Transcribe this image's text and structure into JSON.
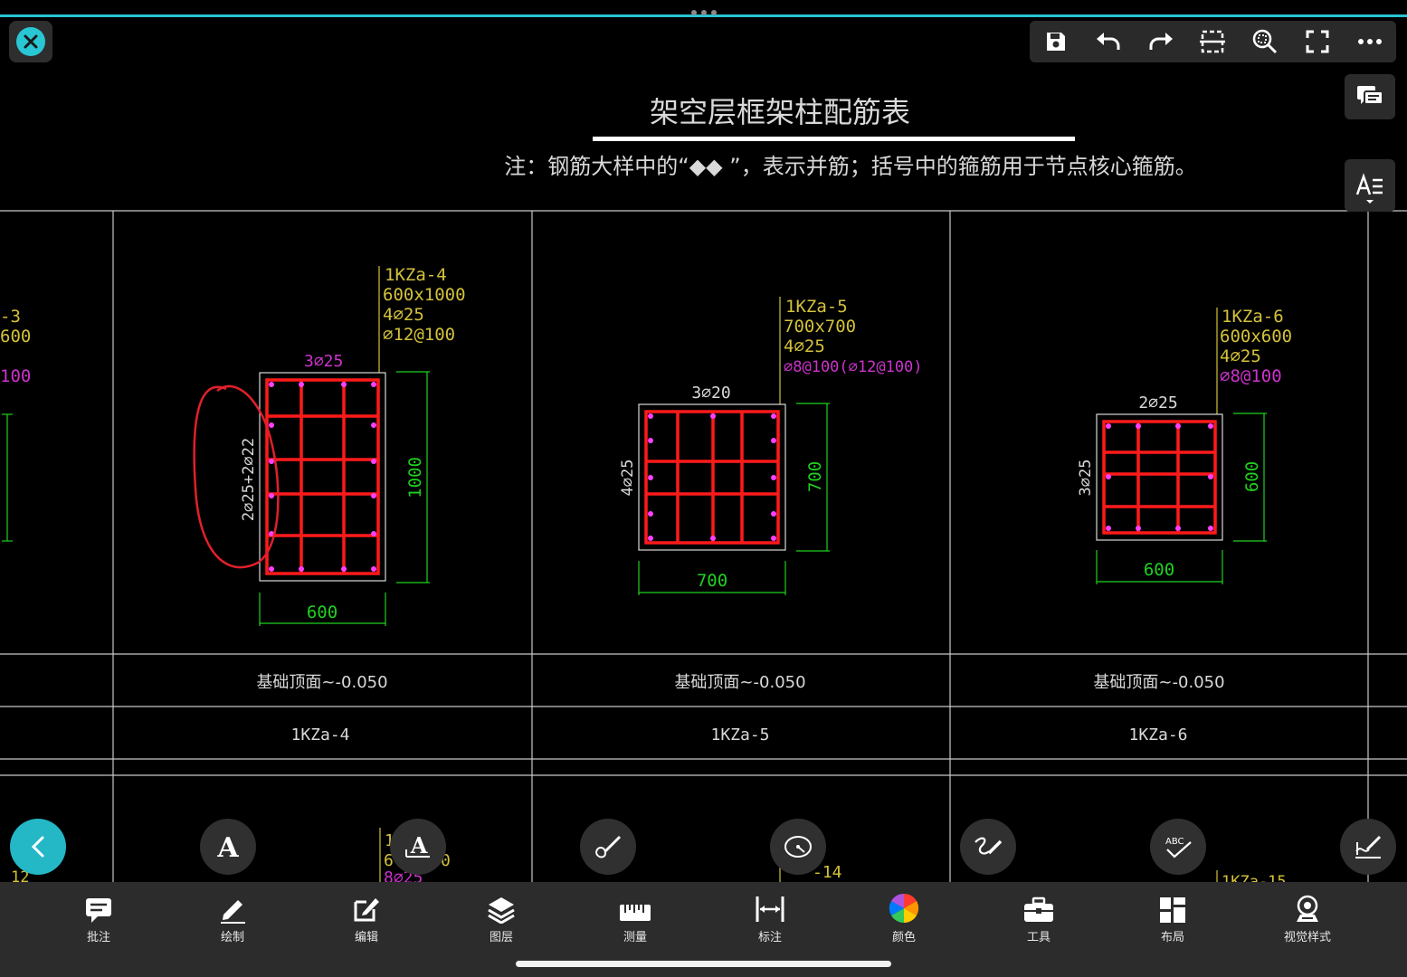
{
  "drawing": {
    "title": "架空层框架柱配筋表",
    "note": "注：钢筋大样中的“◆◆ ”，表示并筋；括号中的箍筋用于节点核心箍筋。",
    "left_partial": {
      "name": "-3",
      "size": "600",
      "stirrup": "100",
      "bottom_label": "12"
    },
    "columns": [
      {
        "id": "1KZa-4",
        "size": "600x1000",
        "corner": "4⌀25",
        "stirrup": "⌀12@100",
        "top_bar": "3⌀25",
        "side_bar": "2⌀25+2⌀22",
        "width_dim": "600",
        "height_dim": "1000",
        "elevation": "基础顶面~-0.050",
        "name": "1KZa-4"
      },
      {
        "id": "1KZa-5",
        "size": "700x700",
        "corner": "4⌀25",
        "stirrup": "⌀8@100(⌀12@100)",
        "top_bar": "3⌀20",
        "side_bar": "4⌀25",
        "width_dim": "700",
        "height_dim": "700",
        "elevation": "基础顶面~-0.050",
        "name": "1KZa-5"
      },
      {
        "id": "1KZa-6",
        "size": "600x600",
        "corner": "4⌀25",
        "stirrup": "⌀8@100",
        "top_bar": "2⌀25",
        "side_bar": "3⌀25",
        "width_dim": "600",
        "height_dim": "600",
        "elevation": "基础顶面~-0.050",
        "name": "1KZa-6"
      }
    ],
    "next_row_fragments": [
      "1",
      "6",
      "8⌀25",
      "0",
      "-14",
      "1KZa-15"
    ]
  },
  "colors": {
    "accent": "#29c6d4",
    "frame": "#d9d9d9",
    "rebar": "#ff1a1a",
    "dot": "#ff40ff",
    "dim": "#1fd11f",
    "label": "#d4c23a",
    "stirrup_label": "#cc33cc",
    "markup": "#e0202a"
  },
  "top_toolbar": {
    "icons": [
      "save-icon",
      "undo-icon",
      "redo-icon",
      "crop-icon",
      "zoom-icon",
      "fullscreen-icon",
      "more-icon"
    ]
  },
  "side_buttons": [
    "comment-list-icon",
    "text-format-icon"
  ],
  "fab_tools": [
    "back-icon",
    "text-icon",
    "text-annotation-icon",
    "brush-icon",
    "measure-circle-icon",
    "freehand-icon",
    "spell-check-icon",
    "sign-icon"
  ],
  "bottom_bar": [
    {
      "label": "批注",
      "icon": "comment-icon"
    },
    {
      "label": "绘制",
      "icon": "pencil-icon"
    },
    {
      "label": "编辑",
      "icon": "edit-icon"
    },
    {
      "label": "图层",
      "icon": "layers-icon"
    },
    {
      "label": "测量",
      "icon": "ruler-icon"
    },
    {
      "label": "标注",
      "icon": "dimension-icon"
    },
    {
      "label": "颜色",
      "icon": "color-wheel-icon"
    },
    {
      "label": "工具",
      "icon": "toolbox-icon"
    },
    {
      "label": "布局",
      "icon": "layout-icon"
    },
    {
      "label": "视觉样式",
      "icon": "visual-style-icon"
    }
  ]
}
